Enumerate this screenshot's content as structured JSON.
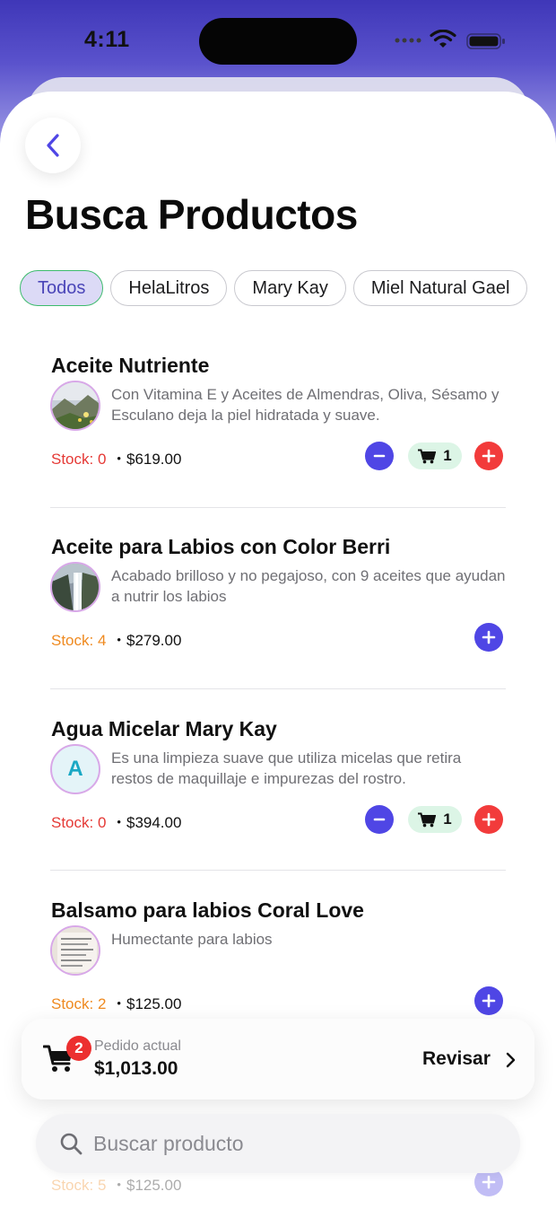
{
  "status_bar": {
    "time": "4:11"
  },
  "header": {
    "title": "Busca Productos"
  },
  "filters": [
    "Todos",
    "HelaLitros",
    "Mary Kay",
    "Miel Natural Gael"
  ],
  "products": [
    {
      "name": "Aceite Nutriente",
      "description": "Con Vitamina E y Aceites de Almendras, Oliva, Sésamo y Esculano deja la piel hidratada y suave.",
      "stock": "Stock: 0",
      "price": "$619.00",
      "cart_qty": "1"
    },
    {
      "name": "Aceite para Labios con Color Berri",
      "description": "Acabado brilloso y no pegajoso, con 9 aceites que ayudan a nutrir los labios",
      "stock": "Stock: 4",
      "price": "$279.00"
    },
    {
      "name": "Agua Micelar Mary Kay",
      "thumb_letter": "A",
      "description": "Es una limpieza suave que utiliza micelas que retira restos de maquillaje e impurezas del rostro.",
      "stock": "Stock: 0",
      "price": "$394.00",
      "cart_qty": "1"
    },
    {
      "name": "Balsamo para labios Coral Love",
      "description": "Humectante para labios",
      "stock": "Stock: 2",
      "price": "$125.00"
    },
    {
      "stock": "Stock: 5",
      "price": "$125.00"
    }
  ],
  "order": {
    "badge": "2",
    "label": "Pedido actual",
    "total": "$1,013.00",
    "review": "Revisar"
  },
  "search": {
    "placeholder": "Buscar producto"
  },
  "colors": {
    "accent": "#4f46e5",
    "danger": "#f23b3b",
    "stock_zero": "#e53935",
    "stock_low": "#ef8a20",
    "chip_active_bg": "#dcdaf6",
    "chip_active_border": "#3dbb6d"
  }
}
